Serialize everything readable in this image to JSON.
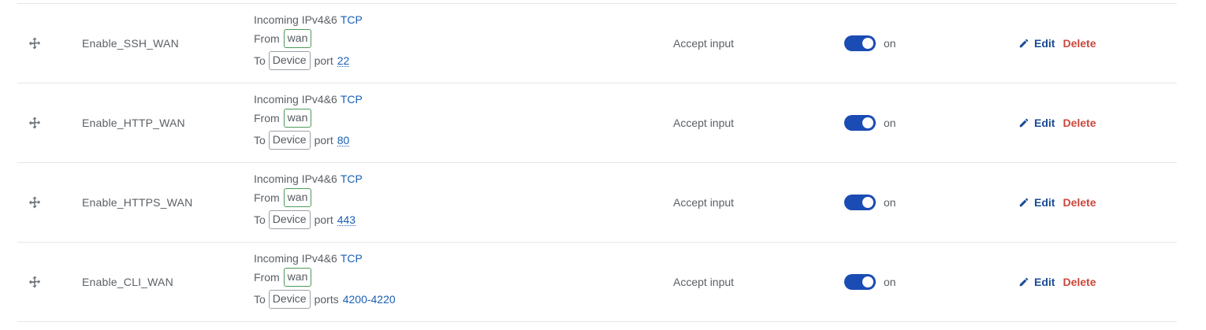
{
  "colors": {
    "link": "#1a5fb4",
    "toggle_on": "#1b4cb3",
    "delete": "#c9483b",
    "zone_border": "#4c9a5a"
  },
  "rules": [
    {
      "name": "Enable_SSH_WAN",
      "incoming": "Incoming IPv4&6",
      "proto": "TCP",
      "from_label": "From",
      "from_zone": "wan",
      "to_label": "To",
      "to_target": "Device",
      "port_label": "port",
      "port_value": "22",
      "action": "Accept input",
      "enabled": true,
      "enabled_label": "on",
      "edit_label": "Edit",
      "delete_label": "Delete"
    },
    {
      "name": "Enable_HTTP_WAN",
      "incoming": "Incoming IPv4&6",
      "proto": "TCP",
      "from_label": "From",
      "from_zone": "wan",
      "to_label": "To",
      "to_target": "Device",
      "port_label": "port",
      "port_value": "80",
      "action": "Accept input",
      "enabled": true,
      "enabled_label": "on",
      "edit_label": "Edit",
      "delete_label": "Delete"
    },
    {
      "name": "Enable_HTTPS_WAN",
      "incoming": "Incoming IPv4&6",
      "proto": "TCP",
      "from_label": "From",
      "from_zone": "wan",
      "to_label": "To",
      "to_target": "Device",
      "port_label": "port",
      "port_value": "443",
      "action": "Accept input",
      "enabled": true,
      "enabled_label": "on",
      "edit_label": "Edit",
      "delete_label": "Delete"
    },
    {
      "name": "Enable_CLI_WAN",
      "incoming": "Incoming IPv4&6",
      "proto": "TCP",
      "from_label": "From",
      "from_zone": "wan",
      "to_label": "To",
      "to_target": "Device",
      "port_label": "ports",
      "port_value": "4200-4220",
      "action": "Accept input",
      "enabled": true,
      "enabled_label": "on",
      "edit_label": "Edit",
      "delete_label": "Delete"
    }
  ]
}
